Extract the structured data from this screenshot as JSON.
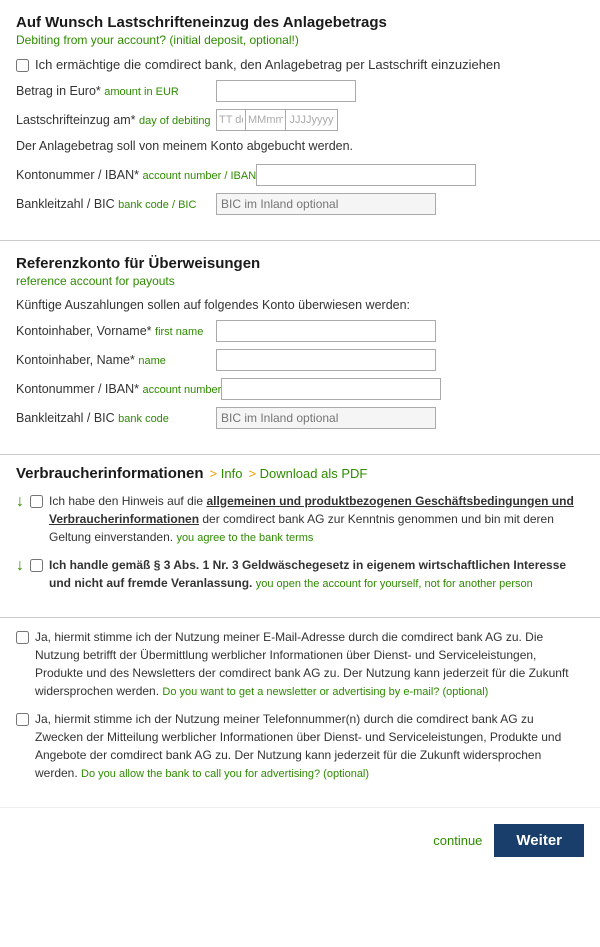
{
  "section1": {
    "title": "Auf Wunsch Lastschrifteneinzug des Anlagebetrags",
    "subtitle": "Debiting from your account? (initial deposit, optional!)",
    "checkbox_label": "Ich ermächtige die comdirect bank, den Anlagebetrag per Lastschrift einzuziehen",
    "betrag_label": "Betrag in Euro*",
    "betrag_hint": "amount in EUR",
    "lastschrift_label": "Lastschrifteinzug am*",
    "lastschrift_hint": "day of debiting",
    "date_dd": "TT dd",
    "date_mm": "MMmm",
    "date_yyyy": "JJJJyyyy",
    "abbuchen_text": "Der Anlagebetrag soll von meinem Konto abgebucht werden.",
    "konto_label": "Kontonummer / IBAN*",
    "konto_hint": "account number / IBAN",
    "bankleitzahl_label": "Bankleitzahl / BIC",
    "bankleitzahl_hint": "bank code / BIC",
    "bic_placeholder": "BIC im Inland optional"
  },
  "section2": {
    "title": "Referenzkonto für Überweisungen",
    "subtitle": "reference account for payouts",
    "info_text": "Künftige Auszahlungen sollen auf folgendes Konto überwiesen werden:",
    "inhaber_vorname_label": "Kontoinhaber, Vorname*",
    "inhaber_vorname_hint": "first name",
    "inhaber_name_label": "Kontoinhaber, Name*",
    "inhaber_name_hint": "name",
    "konto_label": "Kontonummer / IBAN*",
    "konto_hint": "account number",
    "bankleitzahl_label": "Bankleitzahl / BIC",
    "bankleitzahl_hint": "bank code",
    "bic_placeholder": "BIC im Inland optional"
  },
  "section3": {
    "title": "Verbraucherinformationen",
    "link_info": "Info",
    "link_download": "Download als PDF",
    "consent1_text": "Ich habe den Hinweis auf die ",
    "consent1_bold": "allgemeinen und produktbezogenen Geschäftsbedingungen und Verbraucherinformationen",
    "consent1_rest": " der comdirect bank AG zur Kenntnis genommen und bin mit deren Geltung einverstanden.",
    "consent1_hint": "you agree to the bank terms",
    "consent2_text": "Ich handle gemäß § 3 Abs. 1 Nr. 3 Geldwäschegesetz in eigenem wirtschaftlichen Interesse und nicht auf fremde Veranlassung.",
    "consent2_hint": "you open the account for yourself, not for another person"
  },
  "section4": {
    "optional1_text": "Ja, hiermit stimme ich der Nutzung meiner E-Mail-Adresse durch die comdirect bank AG zu. Die Nutzung betrifft der Übermittlung werblicher Informationen über Dienst- und Serviceleistungen, Produkte und des Newsletters der comdirect bank AG zu. Der Nutzung kann jederzeit für die Zukunft widersprochen werden.",
    "optional1_hint": "Do you want to get a newsletter or advertising by e-mail? (optional)",
    "optional2_text": "Ja, hiermit stimme ich der Nutzung meiner Telefonnummer(n) durch die comdirect bank AG zu Zwecken der Mitteilung werblicher Informationen über Dienst- und Serviceleistungen, Produkte und Angebote der comdirect bank AG zu. Der Nutzung kann jederzeit für die Zukunft widersprochen werden.",
    "optional2_hint": "Do you allow the bank to call you for advertising? (optional)"
  },
  "footer": {
    "continue_label": "continue",
    "weiter_label": "Weiter"
  }
}
